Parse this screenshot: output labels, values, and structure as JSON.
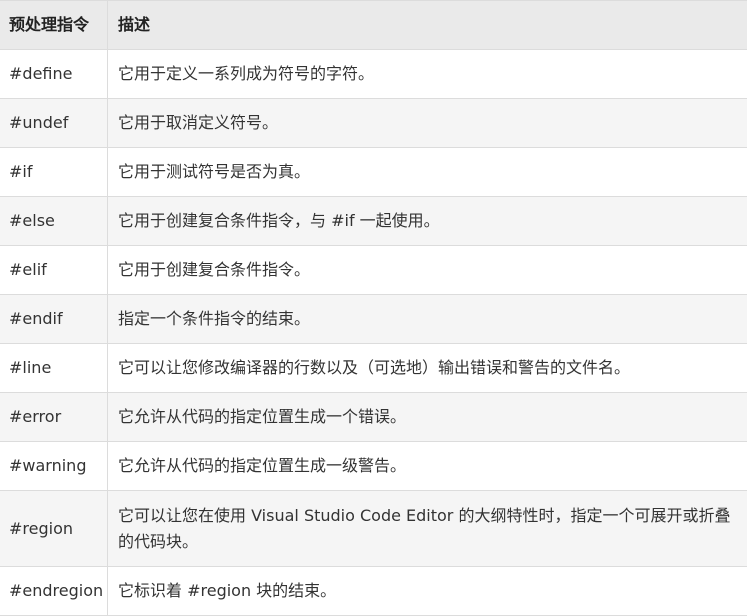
{
  "header": {
    "col1": "预处理指令",
    "col2": "描述"
  },
  "rows": [
    {
      "directive": "#define",
      "description": "它用于定义一系列成为符号的字符。"
    },
    {
      "directive": "#undef",
      "description": "它用于取消定义符号。"
    },
    {
      "directive": "#if",
      "description": "它用于测试符号是否为真。"
    },
    {
      "directive": "#else",
      "description": "它用于创建复合条件指令，与 #if 一起使用。"
    },
    {
      "directive": "#elif",
      "description": "它用于创建复合条件指令。"
    },
    {
      "directive": "#endif",
      "description": "指定一个条件指令的结束。"
    },
    {
      "directive": "#line",
      "description": "它可以让您修改编译器的行数以及（可选地）输出错误和警告的文件名。"
    },
    {
      "directive": "#error",
      "description": "它允许从代码的指定位置生成一个错误。"
    },
    {
      "directive": "#warning",
      "description": "它允许从代码的指定位置生成一级警告。"
    },
    {
      "directive": "#region",
      "description": "它可以让您在使用 Visual Studio Code Editor 的大纲特性时，指定一个可展开或折叠的代码块。"
    },
    {
      "directive": "#endregion",
      "description": "它标识着 #region 块的结束。"
    }
  ]
}
